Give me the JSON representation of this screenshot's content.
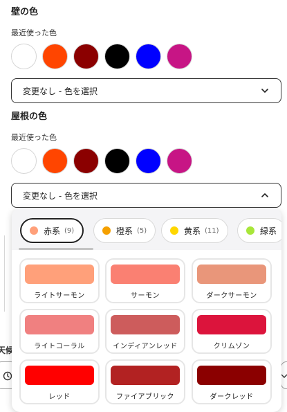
{
  "wall": {
    "title": "壁の色",
    "recent_label": "最近使った色",
    "swatches": [
      {
        "name": "white",
        "color": "#ffffff"
      },
      {
        "name": "orange-red",
        "color": "#ff4500"
      },
      {
        "name": "dark-red",
        "color": "#8b0000"
      },
      {
        "name": "black",
        "color": "#000000"
      },
      {
        "name": "blue",
        "color": "#0000ff"
      },
      {
        "name": "magenta",
        "color": "#c71585"
      }
    ],
    "select_label": "変更なし - 色を選択",
    "select_state": "collapsed"
  },
  "roof": {
    "title": "屋根の色",
    "recent_label": "最近使った色",
    "swatches": [
      {
        "name": "white",
        "color": "#ffffff"
      },
      {
        "name": "orange-red",
        "color": "#ff4500"
      },
      {
        "name": "dark-red",
        "color": "#8b0000"
      },
      {
        "name": "black",
        "color": "#000000"
      },
      {
        "name": "blue",
        "color": "#0000ff"
      },
      {
        "name": "magenta",
        "color": "#c71585"
      }
    ],
    "select_label": "変更なし - 色を選択",
    "select_state": "expanded"
  },
  "background_fragments": {
    "partial_label": "天候"
  },
  "picker": {
    "tabs": [
      {
        "label": "赤系",
        "count": "(9)",
        "dot": "#ffa07a",
        "active": true
      },
      {
        "label": "橙系",
        "count": "(5)",
        "dot": "#f5a000",
        "active": false
      },
      {
        "label": "黄系",
        "count": "(11)",
        "dot": "#ffd700",
        "active": false
      },
      {
        "label": "緑系",
        "count": "",
        "dot": "#a8e63a",
        "active": false
      }
    ],
    "colors": [
      {
        "label": "ライトサーモン",
        "color": "#ffa07a"
      },
      {
        "label": "サーモン",
        "color": "#fa8072"
      },
      {
        "label": "ダークサーモン",
        "color": "#e9967a"
      },
      {
        "label": "ライトコーラル",
        "color": "#f08080"
      },
      {
        "label": "インディアンレッド",
        "color": "#cd5c5c"
      },
      {
        "label": "クリムゾン",
        "color": "#dc143c"
      },
      {
        "label": "レッド",
        "color": "#ff0000"
      },
      {
        "label": "ファイアブリック",
        "color": "#b22222"
      },
      {
        "label": "ダークレッド",
        "color": "#8b0000"
      }
    ]
  }
}
